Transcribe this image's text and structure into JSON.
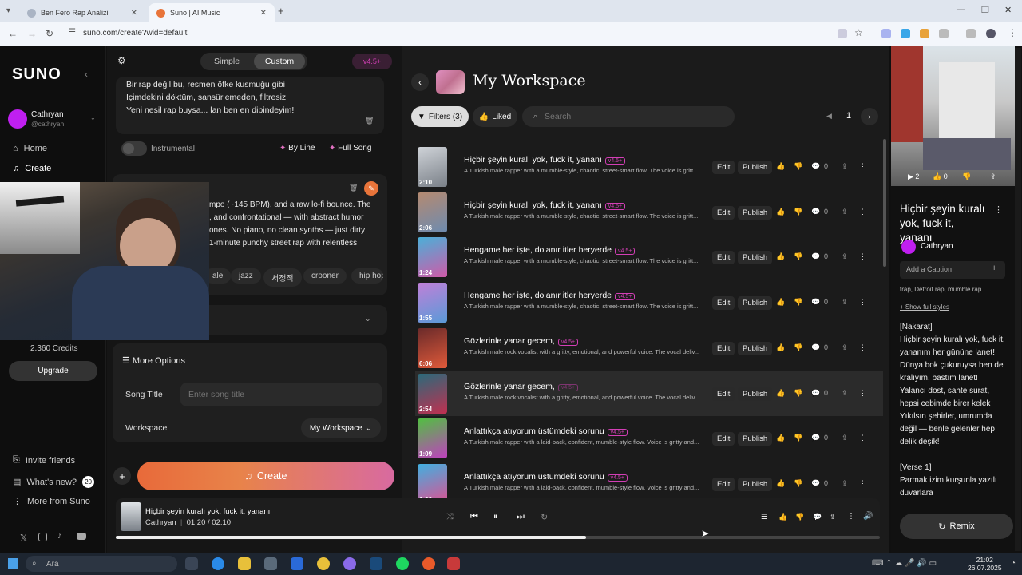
{
  "browser": {
    "tabs": [
      {
        "label": "Ben Fero Rap Analizi",
        "active": false
      },
      {
        "label": "Suno | AI Music",
        "active": true
      }
    ],
    "url": "suno.com/create?wid=default"
  },
  "sidebar": {
    "logo": "SUNO",
    "user_name": "Cathryan",
    "user_handle": "@cathryan",
    "nav": [
      {
        "label": "Home"
      },
      {
        "label": "Create"
      }
    ],
    "credits": "2.360 Credits",
    "upgrade_label": "Upgrade",
    "footer": [
      {
        "label": "Invite friends"
      },
      {
        "label": "What's new?",
        "badge": "20"
      },
      {
        "label": "More from Suno"
      }
    ]
  },
  "create": {
    "mode_simple": "Simple",
    "mode_custom": "Custom",
    "version": "v4.5+",
    "lyrics": [
      "Bir rap değil bu, resmen öfke kusmuğu gibi",
      "İçimdekini döktüm, sansürlemeden, filtresiz",
      "Yeni nesil rap buysa... lan ben en dibindeyim!"
    ],
    "instrumental_label": "Instrumental",
    "by_line_label": "By Line",
    "full_song_label": "Full Song",
    "style_lines": [
      "mpo (~145 BPM), and a raw lo-fi bounce. The",
      ", and confrontational — with abstract humor",
      "ones. No piano, no clean synths — just dirty",
      "1-minute punchy street rap with relentless"
    ],
    "style_tags": [
      "ale",
      "jazz",
      "서정적",
      "crooner",
      "hip hop"
    ],
    "more_options_label": "More Options",
    "song_title_label": "Song Title",
    "song_title_placeholder": "Enter song title",
    "workspace_label": "Workspace",
    "workspace_value": "My Workspace",
    "create_button": "Create"
  },
  "workspace": {
    "title": "My Workspace",
    "filters_label": "Filters (3)",
    "liked_label": "Liked",
    "search_placeholder": "Search",
    "page": "1",
    "edit_label": "Edit",
    "publish_label": "Publish",
    "songs": [
      {
        "title": "Hiçbir şeyin kuralı yok, fuck it, yananı",
        "tag": "v4.5+",
        "desc": "A Turkish male rapper with a mumble-style, chaotic, street-smart flow. The voice is gritt...",
        "duration": "2:10",
        "comments": "0",
        "color1": "#cfd3d8",
        "color2": "#7a8088"
      },
      {
        "title": "Hiçbir şeyin kuralı yok, fuck it, yananı",
        "tag": "v4.5+",
        "desc": "A Turkish male rapper with a mumble-style, chaotic, street-smart flow. The voice is gritt...",
        "duration": "2:06",
        "comments": "0",
        "color1": "#b58a70",
        "color2": "#6d8bb0"
      },
      {
        "title": "Hengame her işte, dolanır itler heryerde",
        "tag": "v4.5+",
        "desc": "A Turkish male rapper with a mumble-style, chaotic, street-smart flow. The voice is gritt...",
        "duration": "1:24",
        "comments": "0",
        "color1": "#4ab0d8",
        "color2": "#d05aa8"
      },
      {
        "title": "Hengame her işte, dolanır itler heryerde",
        "tag": "v4.5+",
        "desc": "A Turkish male rapper with a mumble-style, chaotic, street-smart flow. The voice is gritt...",
        "duration": "1:55",
        "comments": "0",
        "color1": "#c080d8",
        "color2": "#5a9ad8"
      },
      {
        "title": "Gözlerinle yanar gecem,",
        "tag": "v4.5+",
        "desc": "A Turkish male rock vocalist with a gritty, emotional, and powerful voice. The vocal deliv...",
        "duration": "6:06",
        "comments": "0",
        "color1": "#6a2a2a",
        "color2": "#e05a3a"
      },
      {
        "title": "Gözlerinle yanar gecem,",
        "tag": "v4.5+",
        "desc": "A Turkish male rock vocalist with a gritty, emotional, and powerful voice. The vocal deliv...",
        "duration": "2:54",
        "comments": "0",
        "color1": "#2a6a7a",
        "color2": "#c03050"
      },
      {
        "title": "Anlattıkça atıyorum üstümdeki sorunu",
        "tag": "v4.5+",
        "desc": "A Turkish male rapper with a laid-back, confident, mumble-style flow. Voice is gritty and...",
        "duration": "1:09",
        "comments": "0",
        "color1": "#50c040",
        "color2": "#c040c0"
      },
      {
        "title": "Anlattıkça atıyorum üstümdeki sorunu",
        "tag": "v4.5+",
        "desc": "A Turkish male rapper with a laid-back, confident, mumble-style flow. Voice is gritty and...",
        "duration": "1:22",
        "comments": "0",
        "color1": "#40b0e0",
        "color2": "#e05090"
      }
    ]
  },
  "details": {
    "play_count": "2",
    "like_count": "0",
    "title": "Hiçbir şeyin kuralı yok, fuck it, yananı",
    "artist": "Cathryan",
    "caption_placeholder": "Add a Caption",
    "styles": "trap, Detroit rap, mumble rap",
    "show_styles": "+ Show full styles",
    "lyrics": [
      "[Nakarat]",
      "Hiçbir şeyin kuralı yok, fuck it,",
      "yananım her gününe lanet!",
      "Dünya bok çukuruysa ben de",
      "kralıyım, bastım lanet!",
      "Yalancı dost, sahte surat,",
      "hepsi cebimde birer kelek",
      "Yıkılsın şehirler, umrumda",
      "değil — benle gelenler hep",
      "delik deşik!",
      "",
      "[Verse 1]",
      "Parmak izim kurşunla yazılı",
      "duvarlara"
    ],
    "remix_label": "Remix"
  },
  "player": {
    "title": "Hiçbir şeyin kuralı yok, fuck it, yananı",
    "artist": "Cathryan",
    "current": "01:20",
    "total": "02:10",
    "progress": 0.615
  },
  "taskbar": {
    "search_placeholder": "Ara",
    "time": "21:02",
    "date": "26.07.2025"
  }
}
